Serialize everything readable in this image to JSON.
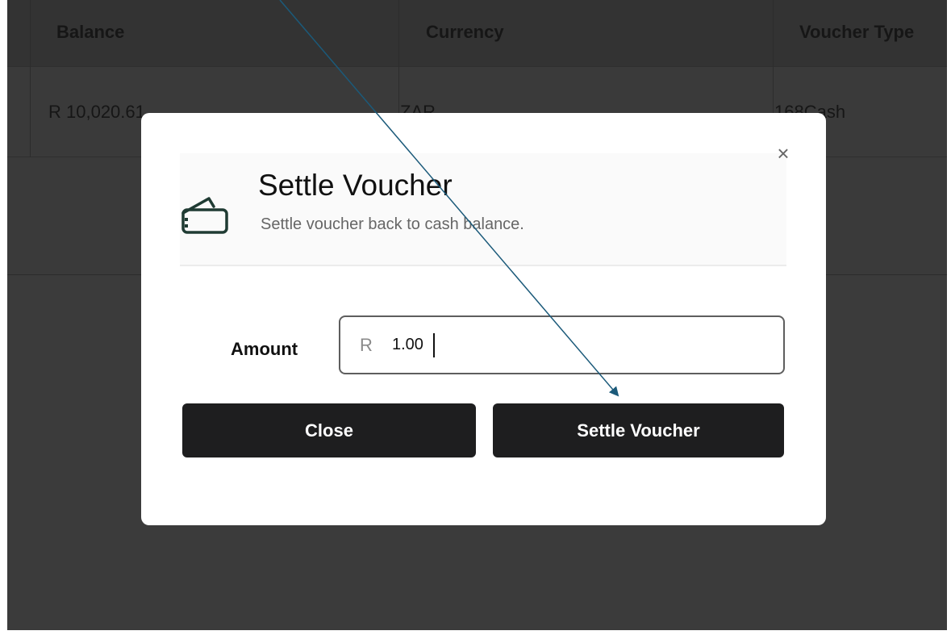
{
  "table": {
    "headers": [
      "Balance",
      "Currency",
      "Voucher Type"
    ],
    "rows": [
      [
        "R 10,020.61",
        "ZAR",
        "168Cash"
      ]
    ]
  },
  "modal": {
    "title": "Settle Voucher",
    "subtitle": "Settle voucher back to cash balance.",
    "close_glyph": "×",
    "icon": "wallet-icon",
    "amount_label": "Amount",
    "currency_prefix": "R",
    "amount_value": "1.00",
    "close_button": "Close",
    "settle_button": "Settle Voucher"
  },
  "colors": {
    "overlay_bg": "#3b3b3b",
    "button_bg": "#1e1e1f",
    "icon_color": "#1f3b33",
    "annotation_arrow": "#1b5a7a"
  }
}
